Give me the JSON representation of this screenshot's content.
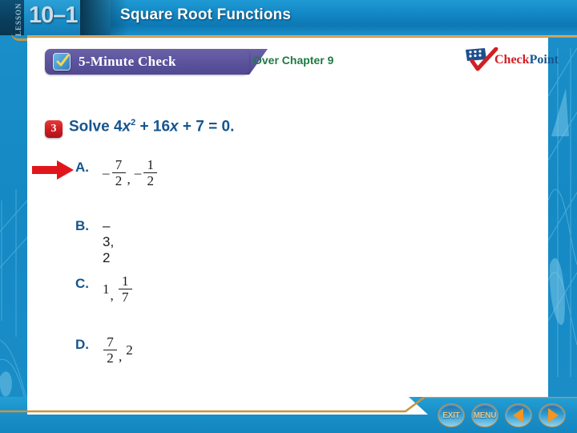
{
  "header": {
    "lesson_word": "LESSON",
    "lesson_number": "10–1",
    "title": "Square Root Functions"
  },
  "toolbar": {
    "check_label": "5-Minute Check",
    "check_icon": "checked-checkbox-icon",
    "over_chapter": "Over Chapter 9",
    "logo": {
      "icon": "flag-check-icon",
      "word_one": "Check",
      "word_two": "Point"
    }
  },
  "question": {
    "number": "3",
    "prompt_prefix": "Solve 4",
    "variable": "x",
    "exponent": "2",
    "prompt_middle": " + 16",
    "variable2": "x",
    "prompt_suffix": " + 7 = 0."
  },
  "pointer": {
    "icon": "right-arrow-icon",
    "points_to": "A"
  },
  "choices": [
    {
      "letter": "A.",
      "text": "– 7/2, – 1/2",
      "parts": [
        {
          "type": "negfrac",
          "num": "7",
          "den": "2"
        },
        {
          "type": "comma",
          "text": ","
        },
        {
          "type": "negfrac",
          "num": "1",
          "den": "2"
        }
      ]
    },
    {
      "letter": "B.",
      "text": "–3, 2",
      "parts": [
        {
          "type": "plain",
          "text": "–3, 2"
        }
      ]
    },
    {
      "letter": "C.",
      "text": "1, 1/7",
      "parts": [
        {
          "type": "plain",
          "text": "1"
        },
        {
          "type": "comma",
          "text": ","
        },
        {
          "type": "frac",
          "num": "1",
          "den": "7"
        }
      ]
    },
    {
      "letter": "D.",
      "text": "7/2, 2",
      "parts": [
        {
          "type": "frac",
          "num": "7",
          "den": "2"
        },
        {
          "type": "comma",
          "text": ","
        },
        {
          "type": "plain",
          "text": "2"
        }
      ]
    }
  ],
  "footer": {
    "exit_label": "EXIT",
    "menu_label": "MENU",
    "prev_icon": "left-triangle-icon",
    "next_icon": "right-triangle-icon"
  },
  "colors": {
    "header_blue": "#1388c6",
    "side_blue": "#1b8ec8",
    "gold_rule": "#c9953f",
    "purple_ribbon": "#5d559e",
    "question_blue": "#16558f",
    "green_text": "#1f7a42",
    "red_badge": "#cc1b22",
    "arrow_red": "#e1161c"
  }
}
